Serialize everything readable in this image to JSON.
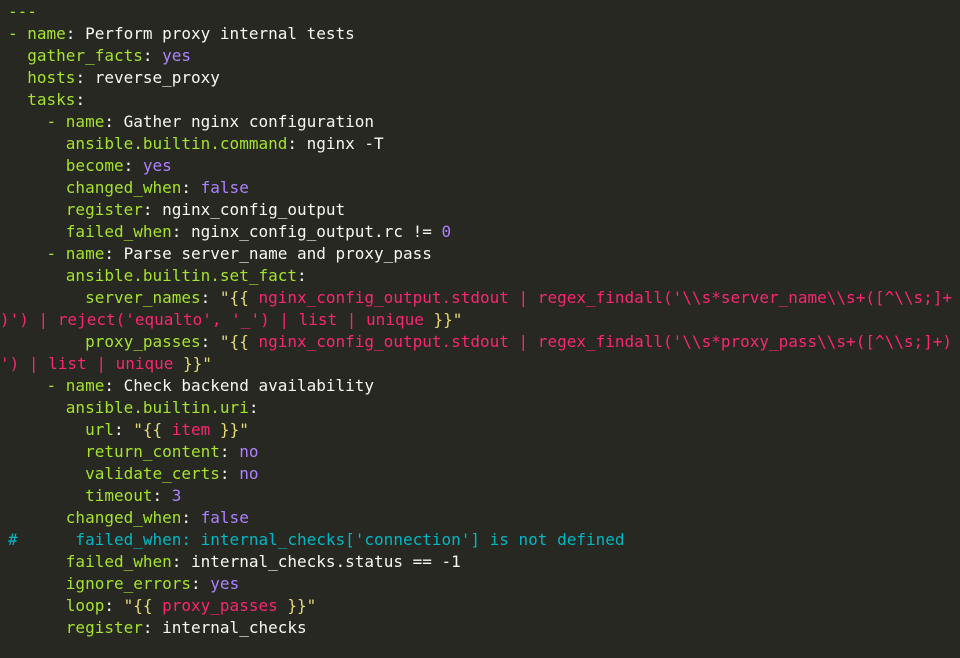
{
  "lines": [
    {
      "parts": [
        {
          "t": "---",
          "c": "y"
        }
      ]
    },
    {
      "parts": [
        {
          "t": "- ",
          "c": "d"
        },
        {
          "t": "name",
          "c": "k"
        },
        {
          "t": ": ",
          "c": "p"
        },
        {
          "t": "Perform proxy internal tests",
          "c": "v"
        }
      ]
    },
    {
      "parts": [
        {
          "t": "  ",
          "c": "p"
        },
        {
          "t": "gather_facts",
          "c": "k"
        },
        {
          "t": ": ",
          "c": "p"
        },
        {
          "t": "yes",
          "c": "b"
        }
      ]
    },
    {
      "parts": [
        {
          "t": "  ",
          "c": "p"
        },
        {
          "t": "hosts",
          "c": "k"
        },
        {
          "t": ": ",
          "c": "p"
        },
        {
          "t": "reverse_proxy",
          "c": "v"
        }
      ]
    },
    {
      "parts": [
        {
          "t": "  ",
          "c": "p"
        },
        {
          "t": "tasks",
          "c": "k"
        },
        {
          "t": ":",
          "c": "p"
        }
      ]
    },
    {
      "parts": [
        {
          "t": "    ",
          "c": "p"
        },
        {
          "t": "- ",
          "c": "d"
        },
        {
          "t": "name",
          "c": "k"
        },
        {
          "t": ": ",
          "c": "p"
        },
        {
          "t": "Gather nginx configuration",
          "c": "v"
        }
      ]
    },
    {
      "parts": [
        {
          "t": "      ",
          "c": "p"
        },
        {
          "t": "ansible.builtin.command",
          "c": "k"
        },
        {
          "t": ": ",
          "c": "p"
        },
        {
          "t": "nginx -T",
          "c": "v"
        }
      ]
    },
    {
      "parts": [
        {
          "t": "      ",
          "c": "p"
        },
        {
          "t": "become",
          "c": "k"
        },
        {
          "t": ": ",
          "c": "p"
        },
        {
          "t": "yes",
          "c": "b"
        }
      ]
    },
    {
      "parts": [
        {
          "t": "      ",
          "c": "p"
        },
        {
          "t": "changed_when",
          "c": "k"
        },
        {
          "t": ": ",
          "c": "p"
        },
        {
          "t": "false",
          "c": "b"
        }
      ]
    },
    {
      "parts": [
        {
          "t": "      ",
          "c": "p"
        },
        {
          "t": "register",
          "c": "k"
        },
        {
          "t": ": ",
          "c": "p"
        },
        {
          "t": "nginx_config_output",
          "c": "v"
        }
      ]
    },
    {
      "parts": [
        {
          "t": "      ",
          "c": "p"
        },
        {
          "t": "failed_when",
          "c": "k"
        },
        {
          "t": ": ",
          "c": "p"
        },
        {
          "t": "nginx_config_output.rc != ",
          "c": "v"
        },
        {
          "t": "0",
          "c": "n"
        }
      ]
    },
    {
      "parts": [
        {
          "t": "    ",
          "c": "p"
        },
        {
          "t": "- ",
          "c": "d"
        },
        {
          "t": "name",
          "c": "k"
        },
        {
          "t": ": ",
          "c": "p"
        },
        {
          "t": "Parse server_name and proxy_pass",
          "c": "v"
        }
      ]
    },
    {
      "parts": [
        {
          "t": "      ",
          "c": "p"
        },
        {
          "t": "ansible.builtin.set_fact",
          "c": "k"
        },
        {
          "t": ":",
          "c": "p"
        }
      ]
    },
    {
      "parts": [
        {
          "t": "        ",
          "c": "p"
        },
        {
          "t": "server_names",
          "c": "k"
        },
        {
          "t": ": ",
          "c": "p"
        },
        {
          "t": "\"{{ ",
          "c": "s"
        },
        {
          "t": "nginx_config_output.stdout | regex_findall('\\\\s*server_name\\\\s+([^\\\\s;]+",
          "c": "f"
        }
      ]
    },
    {
      "wrap": true,
      "parts": [
        {
          "t": ")') | reject('equalto', '_') | list | unique ",
          "c": "f"
        },
        {
          "t": "}}\"",
          "c": "s"
        }
      ]
    },
    {
      "parts": [
        {
          "t": "        ",
          "c": "p"
        },
        {
          "t": "proxy_passes",
          "c": "k"
        },
        {
          "t": ": ",
          "c": "p"
        },
        {
          "t": "\"{{ ",
          "c": "s"
        },
        {
          "t": "nginx_config_output.stdout | regex_findall('\\\\s*proxy_pass\\\\s+([^\\\\s;]+)",
          "c": "f"
        }
      ]
    },
    {
      "wrap": true,
      "parts": [
        {
          "t": "') | list | unique ",
          "c": "f"
        },
        {
          "t": "}}\"",
          "c": "s"
        }
      ]
    },
    {
      "parts": [
        {
          "t": "    ",
          "c": "p"
        },
        {
          "t": "- ",
          "c": "d"
        },
        {
          "t": "name",
          "c": "k"
        },
        {
          "t": ": ",
          "c": "p"
        },
        {
          "t": "Check backend availability",
          "c": "v"
        }
      ]
    },
    {
      "parts": [
        {
          "t": "      ",
          "c": "p"
        },
        {
          "t": "ansible.builtin.uri",
          "c": "k"
        },
        {
          "t": ":",
          "c": "p"
        }
      ]
    },
    {
      "parts": [
        {
          "t": "        ",
          "c": "p"
        },
        {
          "t": "url",
          "c": "k"
        },
        {
          "t": ": ",
          "c": "p"
        },
        {
          "t": "\"{{ ",
          "c": "s"
        },
        {
          "t": "item",
          "c": "f"
        },
        {
          "t": " }}\"",
          "c": "s"
        }
      ]
    },
    {
      "parts": [
        {
          "t": "        ",
          "c": "p"
        },
        {
          "t": "return_content",
          "c": "k"
        },
        {
          "t": ": ",
          "c": "p"
        },
        {
          "t": "no",
          "c": "b"
        }
      ]
    },
    {
      "parts": [
        {
          "t": "        ",
          "c": "p"
        },
        {
          "t": "validate_certs",
          "c": "k"
        },
        {
          "t": ": ",
          "c": "p"
        },
        {
          "t": "no",
          "c": "b"
        }
      ]
    },
    {
      "parts": [
        {
          "t": "        ",
          "c": "p"
        },
        {
          "t": "timeout",
          "c": "k"
        },
        {
          "t": ": ",
          "c": "p"
        },
        {
          "t": "3",
          "c": "n"
        }
      ]
    },
    {
      "parts": [
        {
          "t": "      ",
          "c": "p"
        },
        {
          "t": "changed_when",
          "c": "k"
        },
        {
          "t": ": ",
          "c": "p"
        },
        {
          "t": "false",
          "c": "b"
        }
      ]
    },
    {
      "parts": [
        {
          "t": "#      failed_when: internal_checks['connection'] is not defined",
          "c": "c"
        }
      ]
    },
    {
      "parts": [
        {
          "t": "      ",
          "c": "p"
        },
        {
          "t": "failed_when",
          "c": "k"
        },
        {
          "t": ": ",
          "c": "p"
        },
        {
          "t": "internal_checks.status == -1",
          "c": "v"
        }
      ]
    },
    {
      "parts": [
        {
          "t": "      ",
          "c": "p"
        },
        {
          "t": "ignore_errors",
          "c": "k"
        },
        {
          "t": ": ",
          "c": "p"
        },
        {
          "t": "yes",
          "c": "b"
        }
      ]
    },
    {
      "parts": [
        {
          "t": "      ",
          "c": "p"
        },
        {
          "t": "loop",
          "c": "k"
        },
        {
          "t": ": ",
          "c": "p"
        },
        {
          "t": "\"{{ ",
          "c": "s"
        },
        {
          "t": "proxy_passes",
          "c": "f"
        },
        {
          "t": " }}\"",
          "c": "s"
        }
      ]
    },
    {
      "parts": [
        {
          "t": "      ",
          "c": "p"
        },
        {
          "t": "register",
          "c": "k"
        },
        {
          "t": ": ",
          "c": "p"
        },
        {
          "t": "internal_checks",
          "c": "v"
        }
      ]
    }
  ],
  "colors": {
    "background": "#272822",
    "key": "#a6e22e",
    "value": "#f8f8f2",
    "bool": "#ae81ff",
    "string": "#e6db74",
    "jinja": "#f92672",
    "comment": "#00b7c3"
  }
}
